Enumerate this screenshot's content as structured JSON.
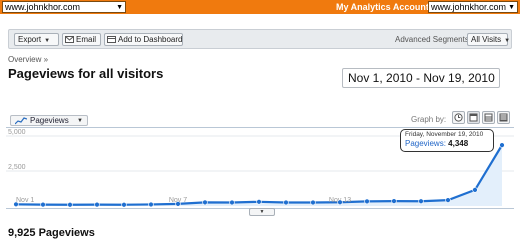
{
  "header": {
    "site_selector_value": "www.johnkhor.com",
    "accounts_label": "My Analytics Accounts:",
    "account_selector_value": "www.johnkhor.com"
  },
  "toolbar": {
    "export_label": "Export",
    "email_label": "Email",
    "add_dashboard_label": "Add to Dashboard",
    "advanced_segments_label": "Advanced Segments:",
    "segment_value": "All Visits"
  },
  "breadcrumb": "Overview »",
  "page_title": "Pageviews for all visitors",
  "date_range": "Nov 1, 2010 - Nov 19, 2010",
  "graph": {
    "metric_label": "Pageviews",
    "graph_by_label": "Graph by:"
  },
  "tooltip": {
    "date": "Friday, November 19, 2010",
    "metric": "Pageviews:",
    "value": "4,348"
  },
  "chart_data": {
    "type": "area",
    "x": [
      "Nov 1",
      "Nov 2",
      "Nov 3",
      "Nov 4",
      "Nov 5",
      "Nov 6",
      "Nov 7",
      "Nov 8",
      "Nov 9",
      "Nov 10",
      "Nov 11",
      "Nov 12",
      "Nov 13",
      "Nov 14",
      "Nov 15",
      "Nov 16",
      "Nov 17",
      "Nov 18",
      "Nov 19"
    ],
    "series": [
      {
        "name": "Pageviews",
        "values": [
          120,
          100,
          90,
          100,
          90,
          110,
          150,
          260,
          250,
          300,
          250,
          250,
          270,
          330,
          350,
          340,
          420,
          1150,
          4348
        ]
      }
    ],
    "ylim": [
      0,
      5000
    ],
    "y_ticks": [
      "5,000",
      "2,500"
    ],
    "x_tick_labels": [
      "Nov 1",
      "Nov 7",
      "Nov 13"
    ],
    "grid": true,
    "color": "#1f6fd0",
    "fill_color": "#e3effb"
  },
  "summary": {
    "total_label": "9,925 Pageviews"
  }
}
